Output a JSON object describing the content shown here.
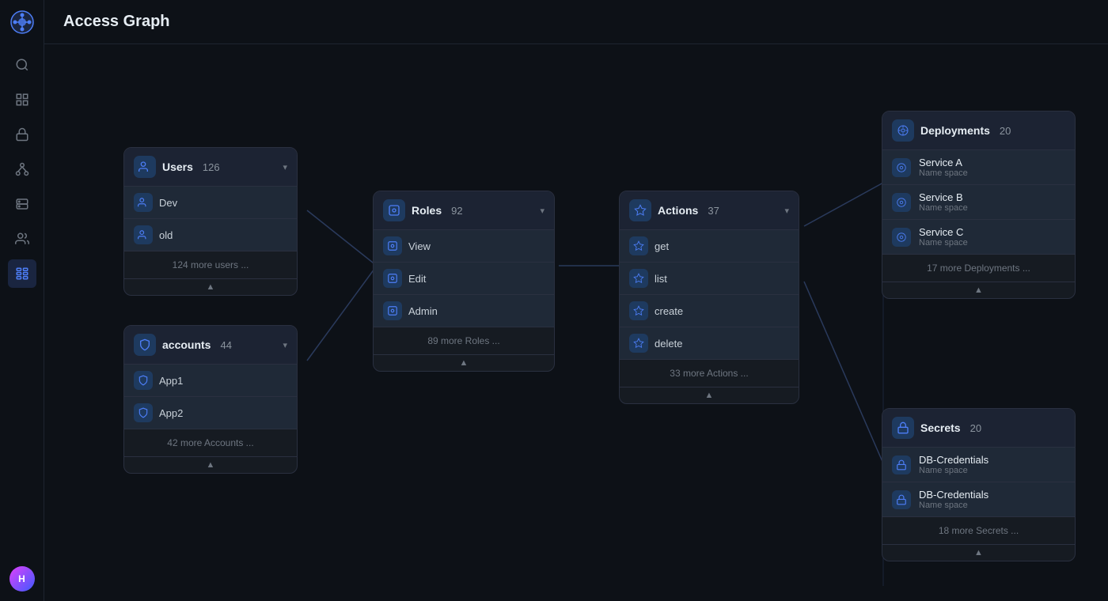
{
  "app": {
    "title": "Access Graph"
  },
  "sidebar": {
    "logo_char": "✦",
    "avatar_char": "H",
    "items": [
      {
        "name": "search",
        "icon": "search",
        "active": false
      },
      {
        "name": "dashboard",
        "icon": "grid",
        "active": false
      },
      {
        "name": "lock",
        "icon": "lock",
        "active": false
      },
      {
        "name": "network",
        "icon": "network",
        "active": false
      },
      {
        "name": "servers",
        "icon": "server",
        "active": false
      },
      {
        "name": "users",
        "icon": "users",
        "active": false
      },
      {
        "name": "access-graph",
        "icon": "graph",
        "active": true
      }
    ]
  },
  "nodes": {
    "users": {
      "title": "Users",
      "count": "126",
      "items": [
        "Dev",
        "old"
      ],
      "more": "124 more users ..."
    },
    "accounts": {
      "title": "accounts",
      "count": "44",
      "items": [
        "App1",
        "App2"
      ],
      "more": "42 more Accounts ..."
    },
    "roles": {
      "title": "Roles",
      "count": "92",
      "items": [
        "View",
        "Edit",
        "Admin"
      ],
      "more": "89 more Roles ..."
    },
    "actions": {
      "title": "Actions",
      "count": "37",
      "items": [
        "get",
        "list",
        "create",
        "delete"
      ],
      "more": "33 more Actions ..."
    },
    "deployments": {
      "title": "Deployments",
      "count": "20",
      "items": [
        {
          "name": "Service A",
          "sub": "Name space"
        },
        {
          "name": "Service B",
          "sub": "Name space"
        },
        {
          "name": "Service C",
          "sub": "Name space"
        }
      ],
      "more": "17 more Deployments ..."
    },
    "secrets": {
      "title": "Secrets",
      "count": "20",
      "items": [
        {
          "name": "DB-Credentials",
          "sub": "Name space"
        },
        {
          "name": "DB-Credentials",
          "sub": "Name space"
        }
      ],
      "more": "18 more Secrets ..."
    }
  }
}
